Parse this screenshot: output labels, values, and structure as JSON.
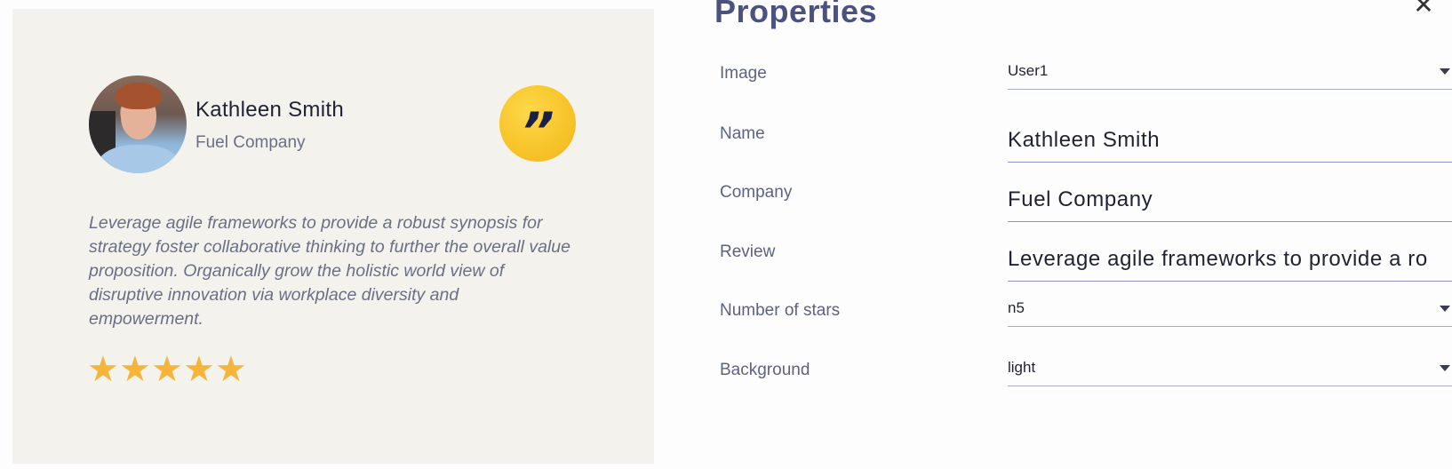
{
  "preview": {
    "name": "Kathleen Smith",
    "company": "Fuel Company",
    "quote_mark": "”",
    "review": "Leverage agile frameworks to provide a robust synopsis for strategy foster collaborative thinking to further the overall value proposition. Organically grow the holistic world view of disruptive innovation via workplace diversity and empowerment.",
    "stars": [
      "★",
      "★",
      "★",
      "★",
      "★"
    ],
    "star_rating": 5,
    "star_color": "#f5b43a",
    "badge_color": "#f6c328"
  },
  "panel": {
    "title": "Properties",
    "close_glyph": "✕",
    "fields": {
      "image": {
        "label": "Image",
        "value": "User1"
      },
      "name": {
        "label": "Name",
        "value": "Kathleen Smith"
      },
      "company": {
        "label": "Company",
        "value": "Fuel Company"
      },
      "review": {
        "label": "Review",
        "value": "Leverage agile frameworks to provide a ro"
      },
      "stars": {
        "label": "Number of stars",
        "value": "n5"
      },
      "background": {
        "label": "Background",
        "value": "light"
      }
    }
  }
}
